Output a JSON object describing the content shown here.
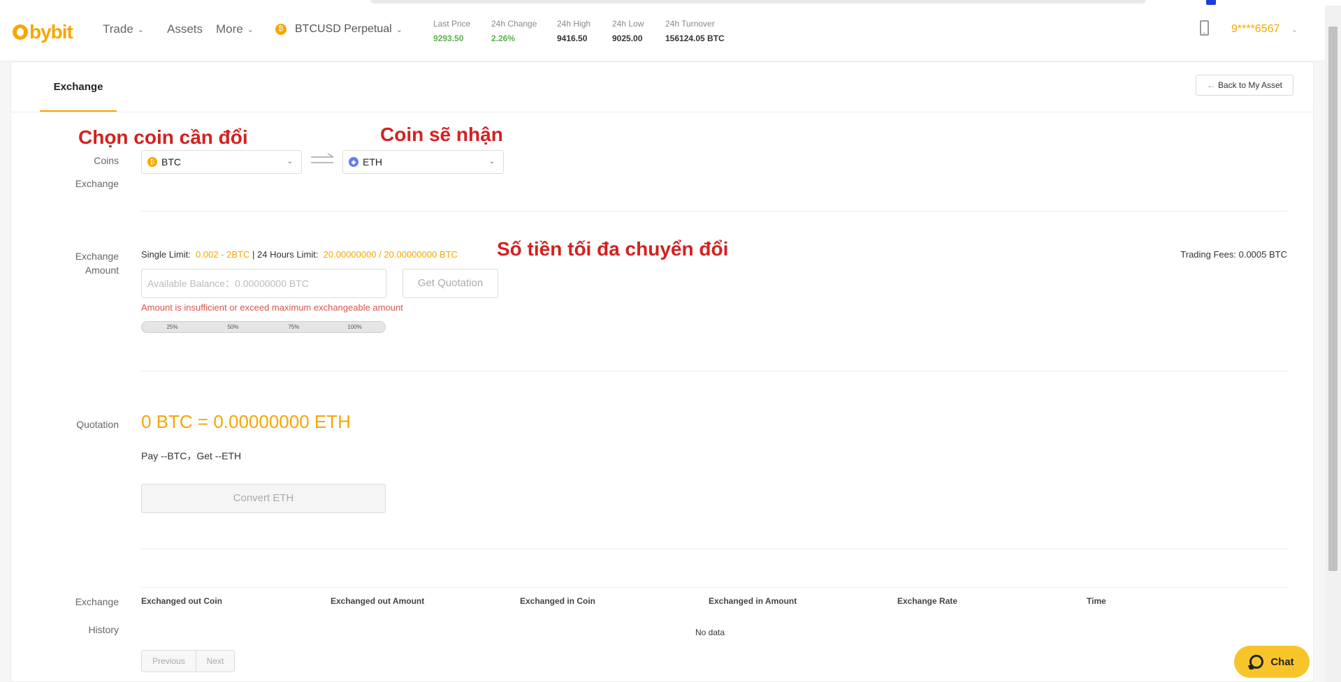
{
  "brand": {
    "name": "bybit",
    "color": "#f7a600"
  },
  "nav": {
    "trade": "Trade",
    "assets": "Assets",
    "more": "More"
  },
  "pair": {
    "name": "BTCUSD Perpetual"
  },
  "ticker": [
    {
      "label": "Last Price",
      "value": "9293.50",
      "tone": "green"
    },
    {
      "label": "24h Change",
      "value": "2.26%",
      "tone": "green"
    },
    {
      "label": "24h High",
      "value": "9416.50",
      "tone": "normal"
    },
    {
      "label": "24h Low",
      "value": "9025.00",
      "tone": "normal"
    },
    {
      "label": "24h Turnover",
      "value": "156124.05 BTC",
      "tone": "normal"
    }
  ],
  "account": {
    "masked_id": "9****6567"
  },
  "page": {
    "tab": "Exchange",
    "back_button": "Back to My Asset"
  },
  "annotations": {
    "select_coin": "Chọn coin cần đổi",
    "receive_coin": "Coin sẽ nhận",
    "max_amount": "Số tiền tối đa chuyển đổi"
  },
  "coins_section": {
    "label_line1": "Coins",
    "label_line2": "Exchange",
    "from_coin": "BTC",
    "to_coin": "ETH"
  },
  "amount_section": {
    "label_line1": "Exchange",
    "label_line2": "Amount",
    "single_limit_label": "Single Limit:",
    "single_limit_value": "0.002 - 2BTC",
    "separator": "|",
    "daily_limit_label": "24 Hours Limit:",
    "daily_limit_value": "20.00000000 / 20.00000000 BTC",
    "trading_fees": "Trading Fees: 0.0005 BTC",
    "input_placeholder": "Available Balance：0.00000000 BTC",
    "quote_button": "Get Quotation",
    "error": "Amount is insufficient or exceed maximum exchangeable amount",
    "percent_options": [
      "25%",
      "50%",
      "75%",
      "100%"
    ]
  },
  "quotation_section": {
    "label": "Quotation",
    "equation": "0 BTC = 0.00000000 ETH",
    "pay_get": "Pay --BTC，Get --ETH",
    "convert_button": "Convert ETH"
  },
  "history_section": {
    "label_line1": "Exchange",
    "label_line2": "History",
    "columns": [
      "Exchanged out Coin",
      "Exchanged out Amount",
      "Exchanged in Coin",
      "Exchanged in Amount",
      "Exchange Rate",
      "Time"
    ],
    "empty_text": "No data",
    "prev_button": "Previous",
    "next_button": "Next"
  },
  "chat": {
    "label": "Chat",
    "color": "#f7c52b"
  },
  "icons": [
    "bybit-logo-icon",
    "btc-coin-icon",
    "eth-coin-icon",
    "swap-arrows-icon",
    "phone-icon",
    "chevron-down-icon",
    "back-arrow-icon",
    "chat-icon"
  ]
}
